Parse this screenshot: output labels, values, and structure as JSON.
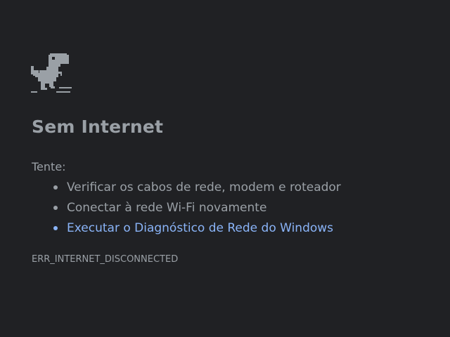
{
  "dino_icon": "offline-dino-icon",
  "heading": "Sem Internet",
  "try_label": "Tente:",
  "suggestions": [
    {
      "label": "Verificar os cabos de rede, modem e roteador"
    },
    {
      "label": "Conectar à rede Wi-Fi novamente"
    },
    {
      "label": "Executar o Diagnóstico de Rede do Windows"
    }
  ],
  "error_code": "ERR_INTERNET_DISCONNECTED",
  "colors": {
    "background": "#202124",
    "text": "#9aa0a6",
    "link": "#8ab4f8"
  }
}
